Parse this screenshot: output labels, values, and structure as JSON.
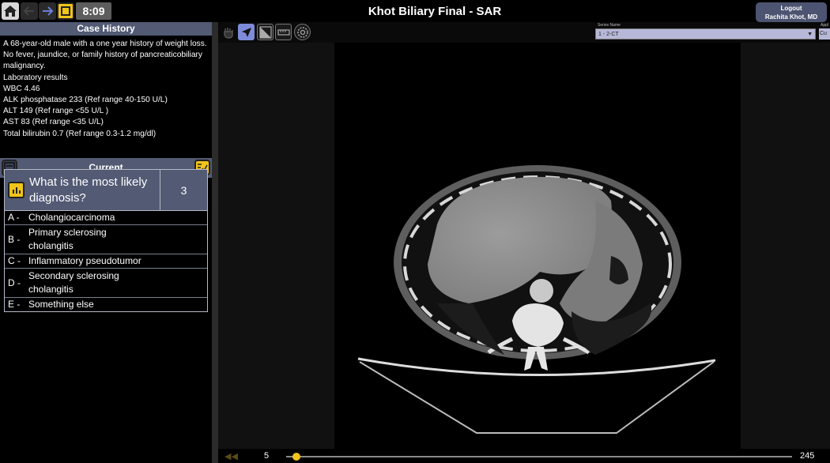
{
  "header": {
    "timer": "8:09",
    "title": "Khot Biliary Final - SAR",
    "logout_label": "Logout",
    "user_name": "Rachita Khot, MD"
  },
  "case_history": {
    "heading": "Case History",
    "lines": [
      "A 68-year-old male with a one year history of weight loss.",
      "No fever, jaundice, or family history of pancreaticobiliary",
      "malignancy.",
      "Laboratory results",
      "WBC 4.46",
      "ALK phosphatase 233 (Ref range 40-150 U/L)",
      "ALT 149 (Ref range <55 U/L )",
      "AST 83 (Ref range <35 U/L)",
      "Total bilirubin 0.7 (Ref range 0.3-1.2 mg/dl)"
    ]
  },
  "current": {
    "label": "Current"
  },
  "question": {
    "text": "What is the most likely diagnosis?",
    "count": "3",
    "options": [
      {
        "letter": "A -",
        "text": "Cholangiocarcinoma"
      },
      {
        "letter": "B -",
        "text": "Primary sclerosing cholangitis"
      },
      {
        "letter": "C -",
        "text": "Inflammatory pseudotumor"
      },
      {
        "letter": "D -",
        "text": "Secondary sclerosing cholangitis"
      },
      {
        "letter": "E -",
        "text": "Something else"
      }
    ]
  },
  "viewer": {
    "series_label": "Series Name",
    "series_value": "1 - 2-CT",
    "apply_label": "Appl",
    "apply_value": "Cu",
    "current_slice": "5",
    "total_slices": "245",
    "slice_fraction": 0.02
  },
  "icons": [
    "home-icon",
    "back-arrow-icon",
    "forward-arrow-icon",
    "stop-icon",
    "pan-icon",
    "pointer-icon",
    "window-level-icon",
    "ruler-icon",
    "settings-icon",
    "notes-icon",
    "checklist-icon",
    "chart-icon"
  ],
  "colors": {
    "accent": "#f0c419",
    "panel_header": "#525a74",
    "selected_tool": "#7e8bd8"
  }
}
